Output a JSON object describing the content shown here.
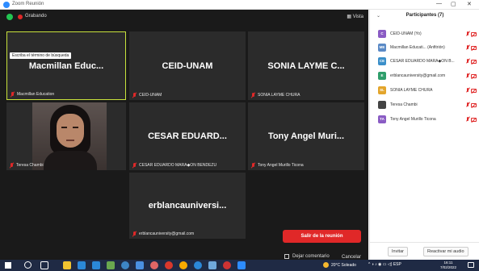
{
  "window": {
    "title": "Zoom Reunión",
    "controls": [
      "—",
      "▢",
      "✕"
    ]
  },
  "meeting": {
    "recording_label": "Grabando",
    "view_label": "Vista",
    "search_tooltip": "Escriba el término de búsqueda",
    "tiles": [
      {
        "big": "Macmillan Educ...",
        "footer": "Macmillan Education",
        "active": true
      },
      {
        "big": "CEID-UNAM",
        "footer": "CEID-UNAM"
      },
      {
        "big": "SONIA LAYME C...",
        "footer": "SONIA LAYME CHURA"
      },
      {
        "big": "",
        "footer": "Teresa Chambi",
        "video": true
      },
      {
        "big": "CESAR EDUARD...",
        "footer": "CESAR EDUARDO MARA◆ON BENDEZU"
      },
      {
        "big": "Tony Angel Muri...",
        "footer": "Tony Angel Murillo Ticona"
      },
      {
        "big": "erblancauniversi...",
        "footer": "erblancauniversity@gmail.com"
      }
    ],
    "leave_button": "Salir de la reunión",
    "dont_ask": "Dejar comentario",
    "cancel": "Cancelar"
  },
  "participants": {
    "header": "Participantes (7)",
    "list": [
      {
        "initials": "C",
        "name": "CEID-UNAM (Yo)",
        "color": "#8a5cc4"
      },
      {
        "initials": "ME",
        "name": "Macmillan Educati... (Anfitrión)",
        "color": "#5b8ac6"
      },
      {
        "initials": "CE",
        "name": "CESAR EDUARDO MARA◆ON B...",
        "color": "#3b8fc9"
      },
      {
        "initials": "E",
        "name": "erblancauniversity@gmail.com",
        "color": "#2f9e6b"
      },
      {
        "initials": "SL",
        "name": "SONIA LAYME CHURA",
        "color": "#e3a52b"
      },
      {
        "initials": "",
        "name": "Teresa Chambi",
        "color": "#444444"
      },
      {
        "initials": "TA",
        "name": "Tony Angel Murillo Ticona",
        "color": "#8a5cc4"
      }
    ],
    "invite_button": "Invitar",
    "unmute_button": "Reactivar mi audio"
  },
  "taskbar": {
    "weather": "20°C Soleado",
    "language": "ESP",
    "time": "16:11",
    "date": "7/02/2022",
    "app_colors": [
      "#f0c330",
      "#2b88d8",
      "#2b88d8",
      "#6aa84f",
      "#3d85c6",
      "#4a90e2",
      "#e06666",
      "#d9382c",
      "#f9ab00",
      "#2b88d8",
      "#6fa8dc",
      "#cc3333",
      "#2d8cff"
    ]
  }
}
